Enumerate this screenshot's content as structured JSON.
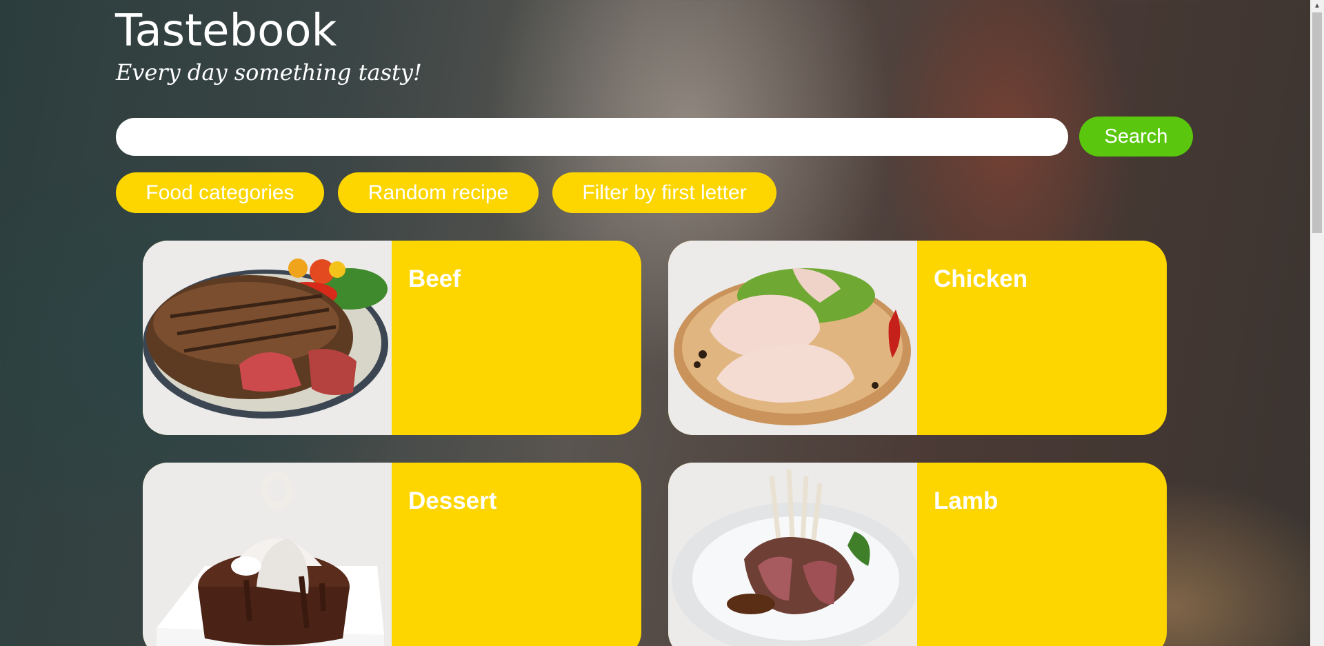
{
  "header": {
    "title": "Tastebook",
    "tagline": "Every day something tasty!"
  },
  "search": {
    "value": "",
    "placeholder": "",
    "button_label": "Search"
  },
  "nav": {
    "categories_label": "Food categories",
    "random_label": "Random recipe",
    "filter_label": "Filter by first letter"
  },
  "categories": [
    {
      "name": "Beef",
      "image": "grilled-steak-plate"
    },
    {
      "name": "Chicken",
      "image": "raw-chicken-legs-board"
    },
    {
      "name": "Dessert",
      "image": "chocolate-lava-cake"
    },
    {
      "name": "Lamb",
      "image": "rack-of-lamb-plate"
    }
  ],
  "colors": {
    "accent_yellow": "#fdd600",
    "search_green": "#5ac70e",
    "text_white": "#ffffff"
  }
}
